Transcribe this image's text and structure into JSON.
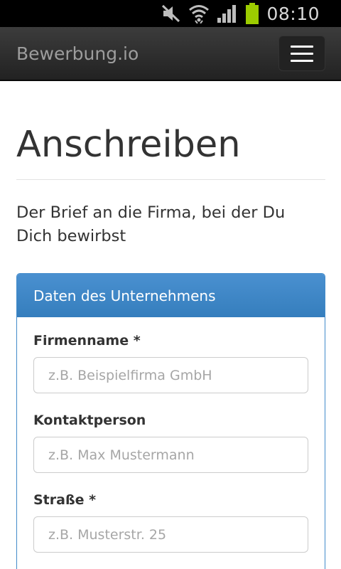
{
  "status_bar": {
    "time": "08:10",
    "icons": [
      "mute-icon",
      "wifi-icon",
      "signal-icon",
      "battery-icon"
    ],
    "battery_color": "#9ccc00"
  },
  "navbar": {
    "brand": "Bewerbung.io",
    "toggle_icon": "hamburger-menu-icon"
  },
  "page": {
    "title": "Anschreiben",
    "lead": "Der Brief an die Firma, bei der Du Dich bewirbst"
  },
  "panel": {
    "heading": "Daten des Unternehmens",
    "accent_color": "#428bca",
    "fields": [
      {
        "label": "Firmenname *",
        "placeholder": "z.B. Beispielfirma GmbH",
        "value": ""
      },
      {
        "label": "Kontaktperson",
        "placeholder": "z.B. Max Mustermann",
        "value": ""
      },
      {
        "label": "Straße *",
        "placeholder": "z.B. Musterstr. 25",
        "value": ""
      }
    ]
  }
}
